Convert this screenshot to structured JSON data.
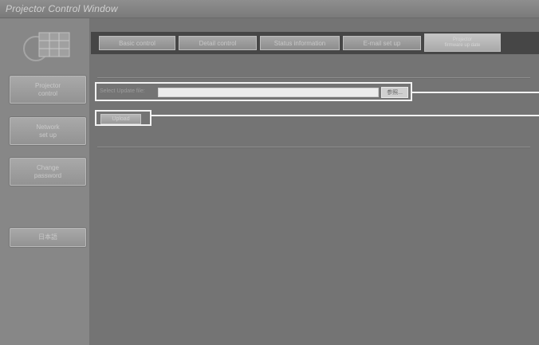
{
  "window": {
    "title": "Projector Control Window"
  },
  "sidebar": {
    "items": [
      {
        "label_lines": [
          "Projector",
          "control"
        ]
      },
      {
        "label_lines": [
          "Network",
          "set up"
        ]
      },
      {
        "label_lines": [
          "Change",
          "password"
        ]
      },
      {
        "label_lines": [
          "日本語"
        ]
      }
    ]
  },
  "tabs": [
    {
      "label": "Basic control"
    },
    {
      "label": "Detail control"
    },
    {
      "label": "Status information"
    },
    {
      "label": "E-mail set up"
    },
    {
      "label_lines": [
        "Projector",
        "firmware up date"
      ],
      "active": true
    }
  ],
  "firmware": {
    "file_label": "Select Update file:",
    "file_value": "",
    "browse_label": "参照...",
    "upload_label": "Upload"
  },
  "colors": {
    "highlight_frame": "#f2f2f2",
    "tab_strip": "#464646"
  }
}
